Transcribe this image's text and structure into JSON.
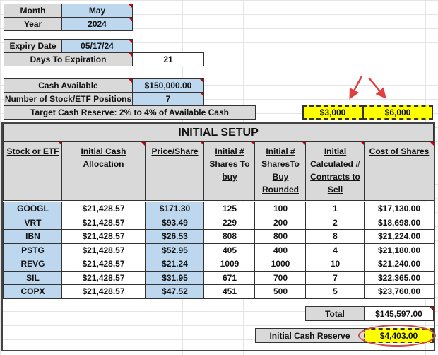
{
  "top": {
    "month_label": "Month",
    "month": "May",
    "year_label": "Year",
    "year": "2024",
    "expiry_label": "Expiry Date",
    "expiry": "05/17/24",
    "dte_label": "Days To Expiration",
    "dte": "21",
    "cash_label": "Cash Available",
    "cash": "$150,000.00",
    "positions_label": "Number of Stock/ETF Positions",
    "positions": "7",
    "reserve_label": "Target Cash Reserve:  2% to 4% of Available Cash",
    "reserve_low": "$3,000",
    "reserve_high": "$6,000"
  },
  "setup": {
    "title": "INITIAL SETUP",
    "headers": [
      "Stock or ETF",
      "Initial Cash Allocation",
      "Price/Share",
      "Initial # Shares To buy",
      "Initial # SharesTo Buy Rounded",
      "Initial Calculated # Contracts to Sell",
      "Cost of Shares"
    ],
    "rows": [
      [
        "GOOGL",
        "$21,428.57",
        "$171.30",
        "125",
        "100",
        "1",
        "$17,130.00"
      ],
      [
        "VRT",
        "$21,428.57",
        "$93.49",
        "229",
        "200",
        "2",
        "$18,698.00"
      ],
      [
        "IBN",
        "$21,428.57",
        "$26.53",
        "808",
        "800",
        "8",
        "$21,224.00"
      ],
      [
        "PSTG",
        "$21,428.57",
        "$52.95",
        "405",
        "400",
        "4",
        "$21,180.00"
      ],
      [
        "REVG",
        "$21,428.57",
        "$21.24",
        "1009",
        "1000",
        "10",
        "$21,240.00"
      ],
      [
        "SIL",
        "$21,428.57",
        "$31.95",
        "671",
        "700",
        "7",
        "$22,365.00"
      ],
      [
        "COPX",
        "$21,428.57",
        "$47.52",
        "451",
        "500",
        "5",
        "$23,760.00"
      ]
    ],
    "total_label": "Total",
    "total": "$145,597.00",
    "initial_reserve_label": "Initial Cash Reserve",
    "initial_reserve": "$4,403.00"
  },
  "colors": {
    "input": "#bdd7ee",
    "label": "#d9d9d9",
    "highlight": "#ffff00",
    "arrow": "#e04040"
  }
}
